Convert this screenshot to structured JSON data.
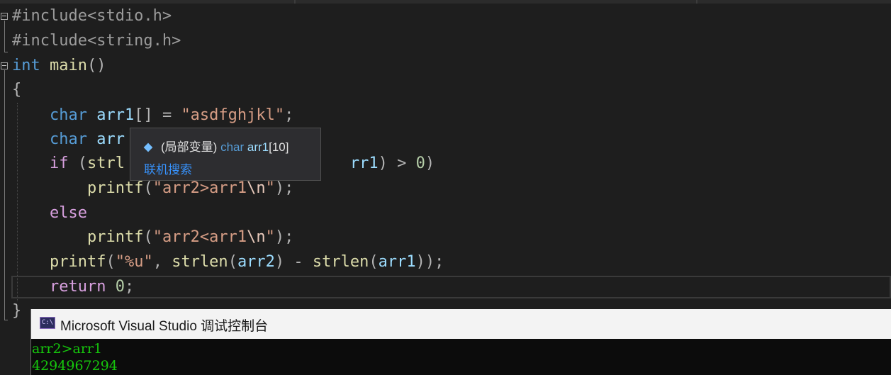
{
  "code": {
    "lines": [
      [
        {
          "t": "#include<stdio.h>",
          "c": "pp"
        }
      ],
      [
        {
          "t": "#include<string.h>",
          "c": "pp"
        }
      ],
      [
        {
          "t": "int",
          "c": "kw"
        },
        {
          "t": " main",
          "c": "fn"
        },
        {
          "t": "()",
          "c": "punc"
        }
      ],
      [
        {
          "t": "{",
          "c": "punc"
        }
      ],
      [
        {
          "t": "    ",
          "c": ""
        },
        {
          "t": "char",
          "c": "kw"
        },
        {
          "t": " arr1",
          "c": "var"
        },
        {
          "t": "[] = ",
          "c": "punc"
        },
        {
          "t": "\"asdfghjkl\"",
          "c": "str"
        },
        {
          "t": ";",
          "c": "punc"
        }
      ],
      [
        {
          "t": "    ",
          "c": ""
        },
        {
          "t": "char",
          "c": "kw"
        },
        {
          "t": " arr",
          "c": "var"
        }
      ],
      [
        {
          "t": "    ",
          "c": ""
        },
        {
          "t": "if",
          "c": "ctl"
        },
        {
          "t": " (",
          "c": "punc"
        },
        {
          "t": "strl",
          "c": "fn"
        },
        {
          "t": "                        ",
          "c": ""
        },
        {
          "t": "rr1",
          "c": "var"
        },
        {
          "t": ") > ",
          "c": "punc"
        },
        {
          "t": "0",
          "c": "num"
        },
        {
          "t": ")",
          "c": "punc"
        }
      ],
      [
        {
          "t": "        ",
          "c": ""
        },
        {
          "t": "printf",
          "c": "fn"
        },
        {
          "t": "(",
          "c": "punc"
        },
        {
          "t": "\"arr2>arr1",
          "c": "str"
        },
        {
          "t": "\\n",
          "c": "esc"
        },
        {
          "t": "\"",
          "c": "str"
        },
        {
          "t": ");",
          "c": "punc"
        }
      ],
      [
        {
          "t": "    ",
          "c": ""
        },
        {
          "t": "else",
          "c": "ctl"
        }
      ],
      [
        {
          "t": "        ",
          "c": ""
        },
        {
          "t": "printf",
          "c": "fn"
        },
        {
          "t": "(",
          "c": "punc"
        },
        {
          "t": "\"arr2<arr1",
          "c": "str"
        },
        {
          "t": "\\n",
          "c": "esc"
        },
        {
          "t": "\"",
          "c": "str"
        },
        {
          "t": ");",
          "c": "punc"
        }
      ],
      [
        {
          "t": "    ",
          "c": ""
        },
        {
          "t": "printf",
          "c": "fn"
        },
        {
          "t": "(",
          "c": "punc"
        },
        {
          "t": "\"%u\"",
          "c": "str"
        },
        {
          "t": ", ",
          "c": "punc"
        },
        {
          "t": "strlen",
          "c": "fn"
        },
        {
          "t": "(",
          "c": "punc"
        },
        {
          "t": "arr2",
          "c": "var"
        },
        {
          "t": ") - ",
          "c": "punc"
        },
        {
          "t": "strlen",
          "c": "fn"
        },
        {
          "t": "(",
          "c": "punc"
        },
        {
          "t": "arr1",
          "c": "var"
        },
        {
          "t": "));",
          "c": "punc"
        }
      ],
      [
        {
          "t": "    ",
          "c": ""
        },
        {
          "t": "return",
          "c": "ctl"
        },
        {
          "t": " ",
          "c": ""
        },
        {
          "t": "0",
          "c": "num"
        },
        {
          "t": ";",
          "c": "punc"
        }
      ],
      [
        {
          "t": "}",
          "c": "punc"
        }
      ]
    ]
  },
  "tooltip": {
    "scope": "(局部变量)",
    "type": "char",
    "name": "arr1",
    "size": "[10]",
    "link": "联机搜索",
    "icon": "local-variable-icon"
  },
  "console": {
    "title": "Microsoft Visual Studio 调试控制台",
    "icon_text": "C:\\",
    "output": [
      "arr2>arr1",
      "4294967294"
    ]
  },
  "colors": {
    "editor_bg": "#1e1e1e",
    "keyword": "#569cd6",
    "string": "#d69d85",
    "console_output": "#16c60c"
  }
}
